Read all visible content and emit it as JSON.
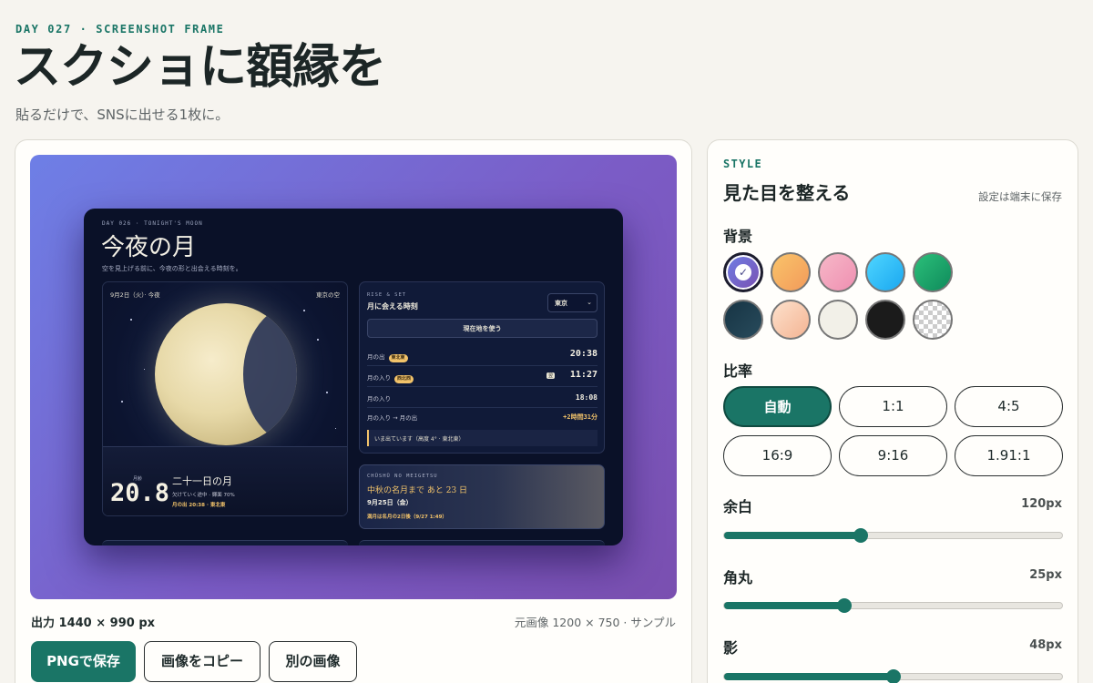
{
  "header": {
    "kicker": "DAY 027 · SCREENSHOT FRAME",
    "title": "スクショに額縁を",
    "subtitle": "貼るだけで、SNSに出せる1枚に。"
  },
  "preview": {
    "output_label": "出力 1440 × 990 px",
    "source_label": "元画像 1200 × 750 · サンプル",
    "inner": {
      "kicker": "DAY 026 · TONIGHT'S MOON",
      "title": "今夜の月",
      "subtitle": "空を見上げる前に、今夜の形と出会える時刻を。",
      "moon_panel": {
        "date": "9月2日（火）· 今夜",
        "place": "東京の空",
        "age_label": "月齢",
        "age": "20.8",
        "name": "二十一日の月",
        "phase": "欠けていく途中 · 輝面 70%",
        "rise": "月の出 20:38 · 東北東",
        "illumination_percent": 70
      },
      "rise_panel": {
        "kicker": "RISE & SET",
        "title": "月に会える時刻",
        "select": "東京",
        "button": "現在地を使う",
        "rows": [
          {
            "label": "月の出",
            "badge": "東北東",
            "value": "20:38"
          },
          {
            "label": "月の入り",
            "badge": "西北西",
            "tag": "翌",
            "value": "11:27"
          },
          {
            "label": "月の入り",
            "value": "18:08"
          },
          {
            "label": "月の入り → 月の出",
            "value": "+2時間31分"
          }
        ],
        "note": "いま出ています（高度 4° · 東北東）"
      },
      "festival_panel": {
        "kicker": "CHŪSHŪ NO MEIGETSU",
        "title": "中秋の名月まで あと 23 日",
        "date": "9月25日（金）",
        "note": "満月は名月の2日後（9/27 1:49）"
      }
    }
  },
  "actions": {
    "save": "PNGで保存",
    "copy": "画像をコピー",
    "other": "別の画像"
  },
  "style_panel": {
    "kicker": "STYLE",
    "title": "見た目を整える",
    "note": "設定は端末に保存",
    "background_label": "背景",
    "swatches": [
      {
        "name": "purple-gradient",
        "color": "#7b6fd6",
        "selected": true
      },
      {
        "name": "orange-gradient",
        "color": "#f6b15e"
      },
      {
        "name": "pink-gradient",
        "color": "#f3a4bd"
      },
      {
        "name": "blue-gradient",
        "color": "#2ec5f7"
      },
      {
        "name": "green-gradient",
        "color": "#1faa6c"
      },
      {
        "name": "navy-gradient",
        "color": "#1b3a4a"
      },
      {
        "name": "peach-gradient",
        "color": "#f8c7ab"
      },
      {
        "name": "cream",
        "color": "#f2f0e8"
      },
      {
        "name": "black",
        "color": "#1b1b1b"
      },
      {
        "name": "transparent",
        "color": "transparent"
      }
    ],
    "ratio_label": "比率",
    "ratios": [
      "自動",
      "1:1",
      "4:5",
      "16:9",
      "9:16",
      "1.91:1"
    ],
    "active_ratio": "自動",
    "sliders": [
      {
        "label": "余白",
        "value": "120px",
        "fraction": 0.405
      },
      {
        "label": "角丸",
        "value": "25px",
        "fraction": 0.355
      },
      {
        "label": "影",
        "value": "48px",
        "fraction": 0.5
      }
    ]
  },
  "colors": {
    "accent": "#1a7566",
    "page_bg": "#f6f4ef",
    "moon_gold": "#f2c36a"
  }
}
